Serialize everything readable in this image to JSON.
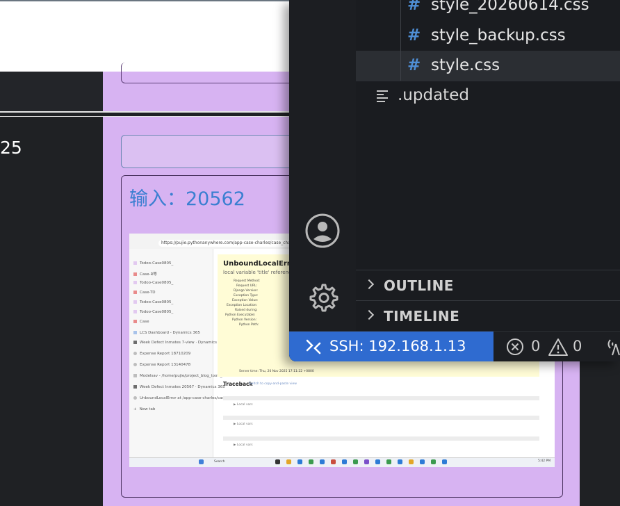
{
  "background_app": {
    "left_number": "25",
    "input_label": "输入：20562"
  },
  "embedded_screenshot": {
    "url": "https://pujie.pythonanywhere.com/app-case-charles/case_charles_search/",
    "sidebar_items": [
      "Todoo-Case0805_",
      "Case-R等",
      "Todoo-Case0805_",
      "Case-TD",
      "Todoo-Case0805_",
      "Todoo-Case0805_",
      "Case",
      "LCS Dashboard - Dynamics 365",
      "Week Defect Inmates 7-view · Dynamics 365",
      "Expense Report 18710209",
      "Expense Report 13140478",
      "Modelsav - /home/pujie/project_blog_tools_fo...",
      "Week Defect Inmates 20567 · Dynamics 365",
      "UnboundLocalError at /app-case-charles/cas...",
      "New tab"
    ],
    "error_title": "UnboundLocalError at",
    "error_subtitle": "local variable 'title' referenced",
    "details": [
      "Request Method:",
      "Request URL:",
      "Django Version:",
      "Exception Type:",
      "Exception Value:",
      "Exception Location:",
      "Raised during:",
      "Python Executable:",
      "Python Version:",
      "Python Path:"
    ],
    "server_time": "Server time:  Thu, 20 Nov 2025 17:11:22 +0800",
    "traceback_title": "Traceback",
    "traceback_hint": "Switch to copy-and-paste view",
    "local_vars": "▶ Local vars",
    "taskbar_search": "Search",
    "clock": "5:42 PM"
  },
  "editor": {
    "files": [
      {
        "icon": "#",
        "name": "style_20260614.css",
        "selected": false
      },
      {
        "icon": "#",
        "name": "style_backup.css",
        "selected": false
      },
      {
        "icon": "#",
        "name": "style.css",
        "selected": true
      }
    ],
    "updated_file": ".updated",
    "sections": [
      "OUTLINE",
      "TIMELINE"
    ],
    "status": {
      "ssh_label": "SSH: 192.168.1.13",
      "errors": "0",
      "warnings": "0"
    },
    "colors": {
      "accent": "#2f6bd0",
      "file_icon": "#4f8fd6",
      "background": "#1c1e22"
    }
  }
}
